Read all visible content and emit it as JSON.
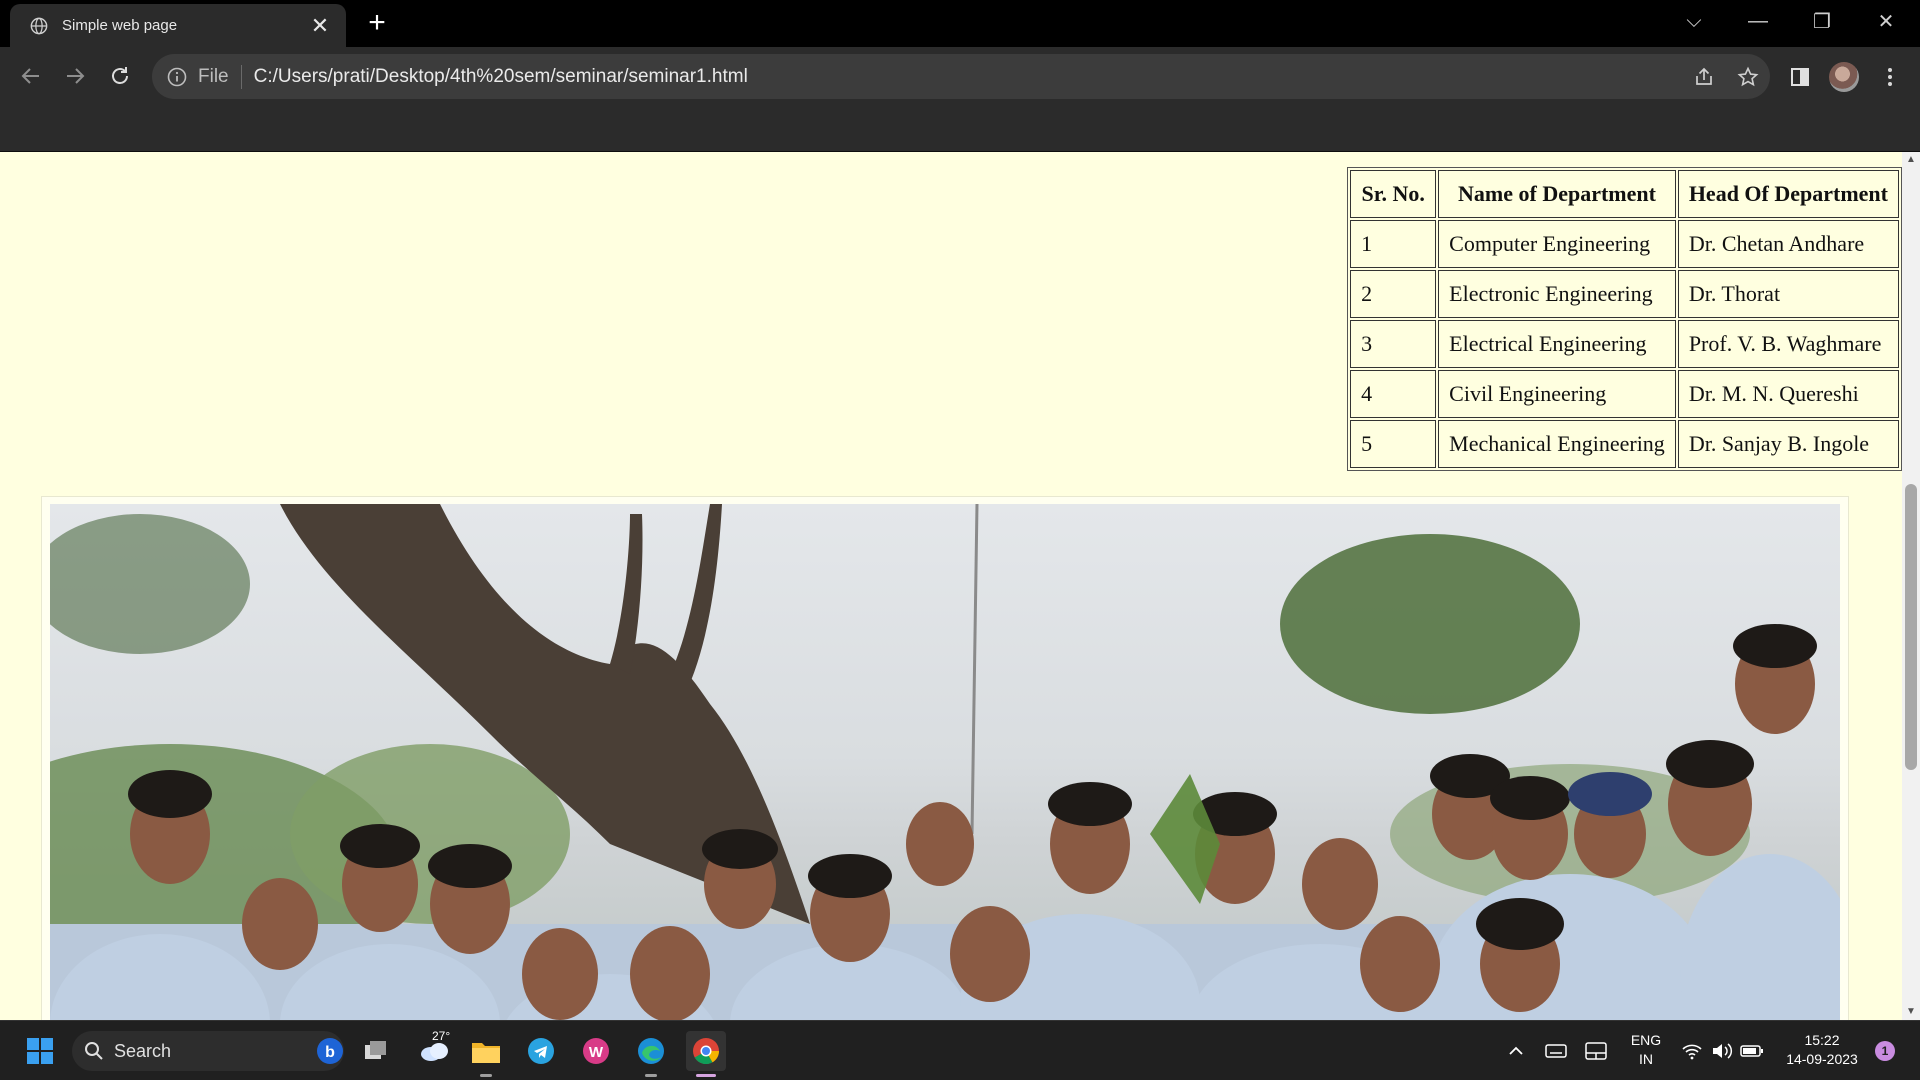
{
  "browser": {
    "tab_title": "Simple web page",
    "close_symbol": "✕",
    "new_tab_symbol": "+",
    "window_controls": {
      "tab_search": "⌵",
      "minimize": "—",
      "restore": "❐",
      "close": "✕"
    },
    "address": {
      "scheme_label": "File",
      "url": "C:/Users/prati/Desktop/4th%20sem/seminar/seminar1.html"
    },
    "icons": {
      "back": "back-arrow-icon",
      "forward": "forward-arrow-icon",
      "reload": "reload-icon",
      "share": "share-icon",
      "bookmark": "star-icon",
      "side_panel": "side-panel-icon",
      "profile": "profile-avatar",
      "menu": "kebab-menu-icon"
    }
  },
  "page": {
    "table": {
      "headers": [
        "Sr. No.",
        "Name of Department",
        "Head Of Department"
      ],
      "rows": [
        [
          "1",
          "Computer Engineering",
          "Dr. Chetan Andhare"
        ],
        [
          "2",
          "Electronic Engineering",
          "Dr. Thorat"
        ],
        [
          "3",
          "Electrical Engineering",
          "Prof. V. B. Waghmare"
        ],
        [
          "4",
          "Civil Engineering",
          "Dr. M. N. Quereshi"
        ],
        [
          "5",
          "Mechanical Engineering",
          "Dr. Sanjay B. Ingole"
        ]
      ]
    },
    "photo": {
      "subject": "group-photo"
    },
    "colors": {
      "background": "#ffffe0"
    }
  },
  "taskbar": {
    "search_placeholder": "Search",
    "weather_temp": "27°",
    "language_line1": "ENG",
    "language_line2": "IN",
    "time": "15:22",
    "date": "14-09-2023",
    "notification_count": "1"
  }
}
